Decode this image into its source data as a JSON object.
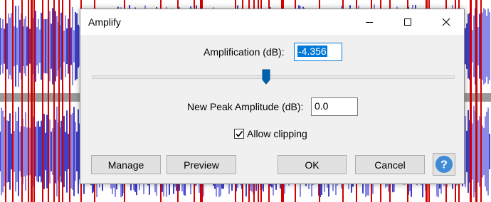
{
  "dialog": {
    "title": "Amplify",
    "amplification_label": "Amplification (dB):",
    "amplification_value": "-4.356",
    "amplification_slider_fraction": 0.48,
    "new_peak_label": "New Peak Amplitude (dB):",
    "new_peak_value": "0.0",
    "allow_clipping_label": "Allow clipping",
    "allow_clipping_checked": true,
    "buttons": {
      "manage": "Manage",
      "preview": "Preview",
      "ok": "OK",
      "cancel": "Cancel",
      "help": "?"
    }
  },
  "colors": {
    "waveform": "#3f3fc8",
    "waveform_light": "#8a8ae6",
    "marker": "#d40000",
    "help_blue": "#3f8bd6",
    "selection": "#0078d7"
  }
}
